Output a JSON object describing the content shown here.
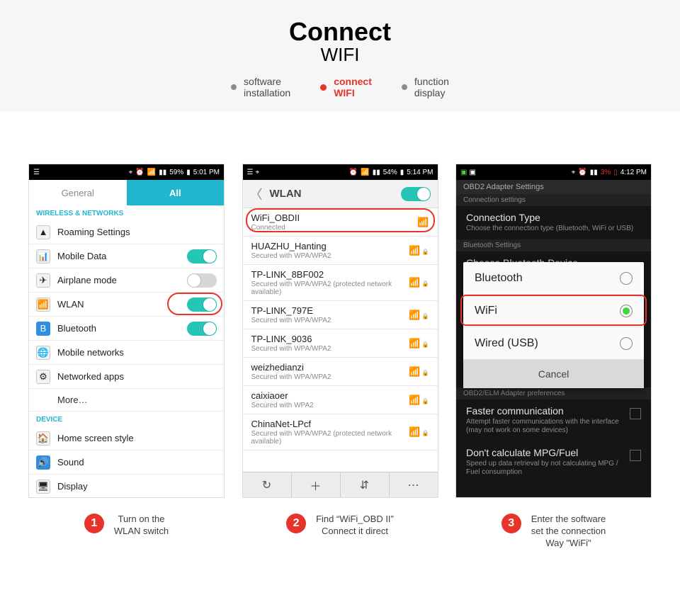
{
  "header": {
    "title": "Connect",
    "subtitle": "WIFI"
  },
  "breadcrumb": [
    {
      "l1": "software",
      "l2": "installation",
      "active": false
    },
    {
      "l1": "connect",
      "l2": "WIFI",
      "active": true
    },
    {
      "l1": "function",
      "l2": "display",
      "active": false
    }
  ],
  "phone1": {
    "status_time": "5:01 PM",
    "status_batt": "59%",
    "tabs": {
      "left": "General",
      "right": "All"
    },
    "section_wireless": "WIRELESS & NETWORKS",
    "rows_wireless": [
      {
        "icon": "▲",
        "label": "Roaming Settings",
        "toggle": null
      },
      {
        "icon": "📊",
        "label": "Mobile Data",
        "toggle": "on"
      },
      {
        "icon": "✈",
        "label": "Airplane mode",
        "toggle": "off"
      },
      {
        "icon": "📶",
        "label": "WLAN",
        "toggle": "on",
        "highlight": true
      },
      {
        "icon": "B",
        "label": "Bluetooth",
        "toggle": "on"
      },
      {
        "icon": "🌐",
        "label": "Mobile networks",
        "toggle": null
      },
      {
        "icon": "⚙",
        "label": "Networked apps",
        "toggle": null
      }
    ],
    "more": "More…",
    "section_device": "DEVICE",
    "rows_device": [
      {
        "icon": "🏠",
        "label": "Home screen style"
      },
      {
        "icon": "🔊",
        "label": "Sound"
      },
      {
        "icon": "🖥",
        "label": "Display"
      }
    ]
  },
  "phone2": {
    "status_time": "5:14 PM",
    "status_batt": "54%",
    "title": "WLAN",
    "networks": [
      {
        "name": "WiFi_OBDII",
        "sec": "Connected",
        "lock": false,
        "highlight": true
      },
      {
        "name": "HUAZHU_Hanting",
        "sec": "Secured with WPA/WPA2",
        "lock": true
      },
      {
        "name": "TP-LINK_8BF002",
        "sec": "Secured with WPA/WPA2 (protected network available)",
        "lock": true
      },
      {
        "name": "TP-LINK_797E",
        "sec": "Secured with WPA/WPA2",
        "lock": true
      },
      {
        "name": "TP-LINK_9036",
        "sec": "Secured with WPA/WPA2",
        "lock": true
      },
      {
        "name": "weizhedianzi",
        "sec": "Secured with WPA/WPA2",
        "lock": true
      },
      {
        "name": "caixiaoer",
        "sec": "Secured with WPA2",
        "lock": true
      },
      {
        "name": "ChinaNet-LPcf",
        "sec": "Secured with WPA/WPA2 (protected network available)",
        "lock": true
      }
    ],
    "bottom_icons": [
      "↻",
      "＋",
      "⇵",
      "⋯"
    ]
  },
  "phone3": {
    "status_time": "4:12 PM",
    "status_batt": "3%",
    "title_bar": "OBD2 Adapter Settings",
    "sub_bar": "Connection settings",
    "items_top": [
      {
        "title": "Connection Type",
        "desc": "Choose the connection type (Bluetooth, WiFi or USB)"
      }
    ],
    "bt_settings_label": "Bluetooth Settings",
    "choose_bt": "Choose Bluetooth Device",
    "modal": {
      "options": [
        "Bluetooth",
        "WiFi",
        "Wired (USB)"
      ],
      "selected": 1,
      "cancel": "Cancel"
    },
    "obd_prefs": "OBD2/ELM Adapter preferences",
    "items_bottom": [
      {
        "title": "Faster communication",
        "desc": "Attempt faster communications with the interface (may not work on some devices)"
      },
      {
        "title": "Don't calculate MPG/Fuel",
        "desc": "Speed up data retrieval by not calculating MPG / Fuel consumption"
      }
    ]
  },
  "captions": [
    {
      "n": "1",
      "l1": "Turn on the",
      "l2": "WLAN switch"
    },
    {
      "n": "2",
      "l1": "Find  “WiFi_OBD II”",
      "l2": "Connect it direct"
    },
    {
      "n": "3",
      "l1": "Enter the software",
      "l2": "set the connection",
      "l3": "Way \"WiFi\""
    }
  ]
}
